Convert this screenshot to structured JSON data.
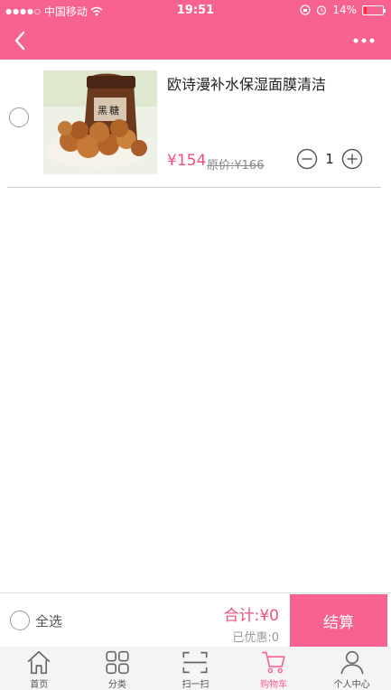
{
  "status_bar": {
    "signal": "●●●●○",
    "carrier": "中国移动",
    "time": "19:51",
    "battery": "14%"
  },
  "cart": {
    "items": [
      {
        "title": "欧诗漫补水保湿面膜清洁",
        "price": "¥154",
        "original_price": "原价:¥166",
        "quantity": "1"
      }
    ]
  },
  "checkout": {
    "select_all_label": "全选",
    "total": "合计:¥0",
    "discount": "已优惠:0",
    "settle_label": "结算"
  },
  "tabbar": {
    "items": [
      {
        "label": "首页",
        "icon": "home-icon"
      },
      {
        "label": "分类",
        "icon": "category-icon"
      },
      {
        "label": "扫一扫",
        "icon": "scan-icon"
      },
      {
        "label": "购物车",
        "icon": "cart-icon"
      },
      {
        "label": "个人中心",
        "icon": "user-icon"
      }
    ],
    "active": 3
  },
  "colors": {
    "brand": "#f86290",
    "price": "#f14f7b"
  }
}
